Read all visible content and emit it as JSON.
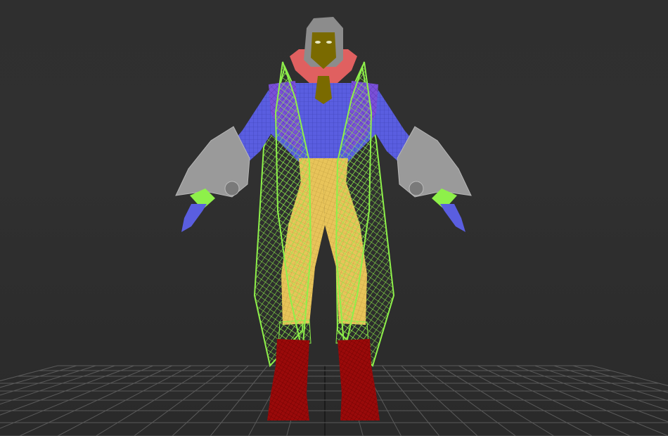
{
  "viewport": {
    "background": "#2f2f2f",
    "grid_color": "#5a5a5a",
    "grid_axis_color": "#141414",
    "grid_visible": true
  },
  "model": {
    "parts": [
      {
        "name": "hair",
        "color": "#8c8c8c"
      },
      {
        "name": "face",
        "color": "#7a6a00"
      },
      {
        "name": "collar",
        "color": "#e06060"
      },
      {
        "name": "shirt",
        "color": "#5a5ee0"
      },
      {
        "name": "coat",
        "color": "#8ef04a"
      },
      {
        "name": "pants",
        "color": "#e8c45a"
      },
      {
        "name": "boots",
        "color": "#9a0a0a"
      },
      {
        "name": "gauntlets",
        "color": "#9a9a9a"
      },
      {
        "name": "hands",
        "color": "#5a5ee0"
      }
    ]
  }
}
